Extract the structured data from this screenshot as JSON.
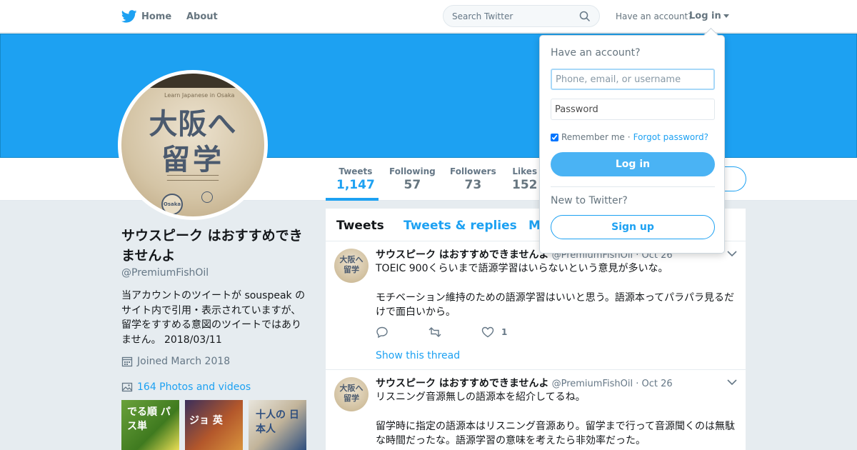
{
  "nav": {
    "home_label": "Home",
    "about_label": "About",
    "search_placeholder": "Search Twitter",
    "have_account": "Have an account?",
    "login_label": "Log in"
  },
  "avatar_image": {
    "subtitle": "Learn Japanese in Osaka",
    "line1": "大阪へ",
    "line2": "留学",
    "badge": "Osaka"
  },
  "stats": [
    {
      "label": "Tweets",
      "value": "1,147",
      "active": true
    },
    {
      "label": "Following",
      "value": "57"
    },
    {
      "label": "Followers",
      "value": "73"
    },
    {
      "label": "Likes",
      "value": "152"
    }
  ],
  "profile": {
    "name": "サウスピーク はおすすめできませんよ",
    "handle": "@PremiumFishOil",
    "bio": "当アカウントのツイートが souspeak のサイト内で引用・表示されていますが、留学をすすめる意図のツイートではありません。 2018/03/11",
    "joined": "Joined March 2018",
    "photos_label": "164 Photos and videos",
    "thumbs": [
      "でる順 パス単",
      "ジョ 英",
      "十人の 日本人"
    ]
  },
  "timeline": {
    "tabs": [
      "Tweets",
      "Tweets & replies",
      "M"
    ],
    "tweets": [
      {
        "author": "サウスピーク はおすすめできませんよ",
        "handle": "@PremiumFishOil",
        "dot": "·",
        "time": "Oct 26",
        "paragraphs": [
          "TOEIC 900くらいまで語源学習はいらないという意見が多いな。",
          "モチベーション維持のための語源学習はいいと思う。語源本ってパラパラ見るだけで面白いから。"
        ],
        "likes": "1",
        "show_thread": "Show this thread"
      },
      {
        "author": "サウスピーク はおすすめできませんよ",
        "handle": "@PremiumFishOil",
        "dot": "·",
        "time": "Oct 26",
        "paragraphs": [
          "リスニング音源無しの語源本を紹介してるね。",
          "留学時に指定の語源本はリスニング音源あり。留学まで行って音源聞くのは無駄な時間だったな。語源学習の意味を考えたら非効率だった。"
        ]
      }
    ]
  },
  "login_dropdown": {
    "heading": "Have an account?",
    "username_placeholder": "Phone, email, or username",
    "password_placeholder": "Password",
    "remember_label": "Remember me",
    "separator": "·",
    "forgot_label": "Forgot password?",
    "login_button": "Log in",
    "new_label": "New to Twitter?",
    "signup_button": "Sign up"
  },
  "colors": {
    "accent": "#1da1f2",
    "banner": "#1da1f2",
    "background": "#e6ecf0"
  }
}
